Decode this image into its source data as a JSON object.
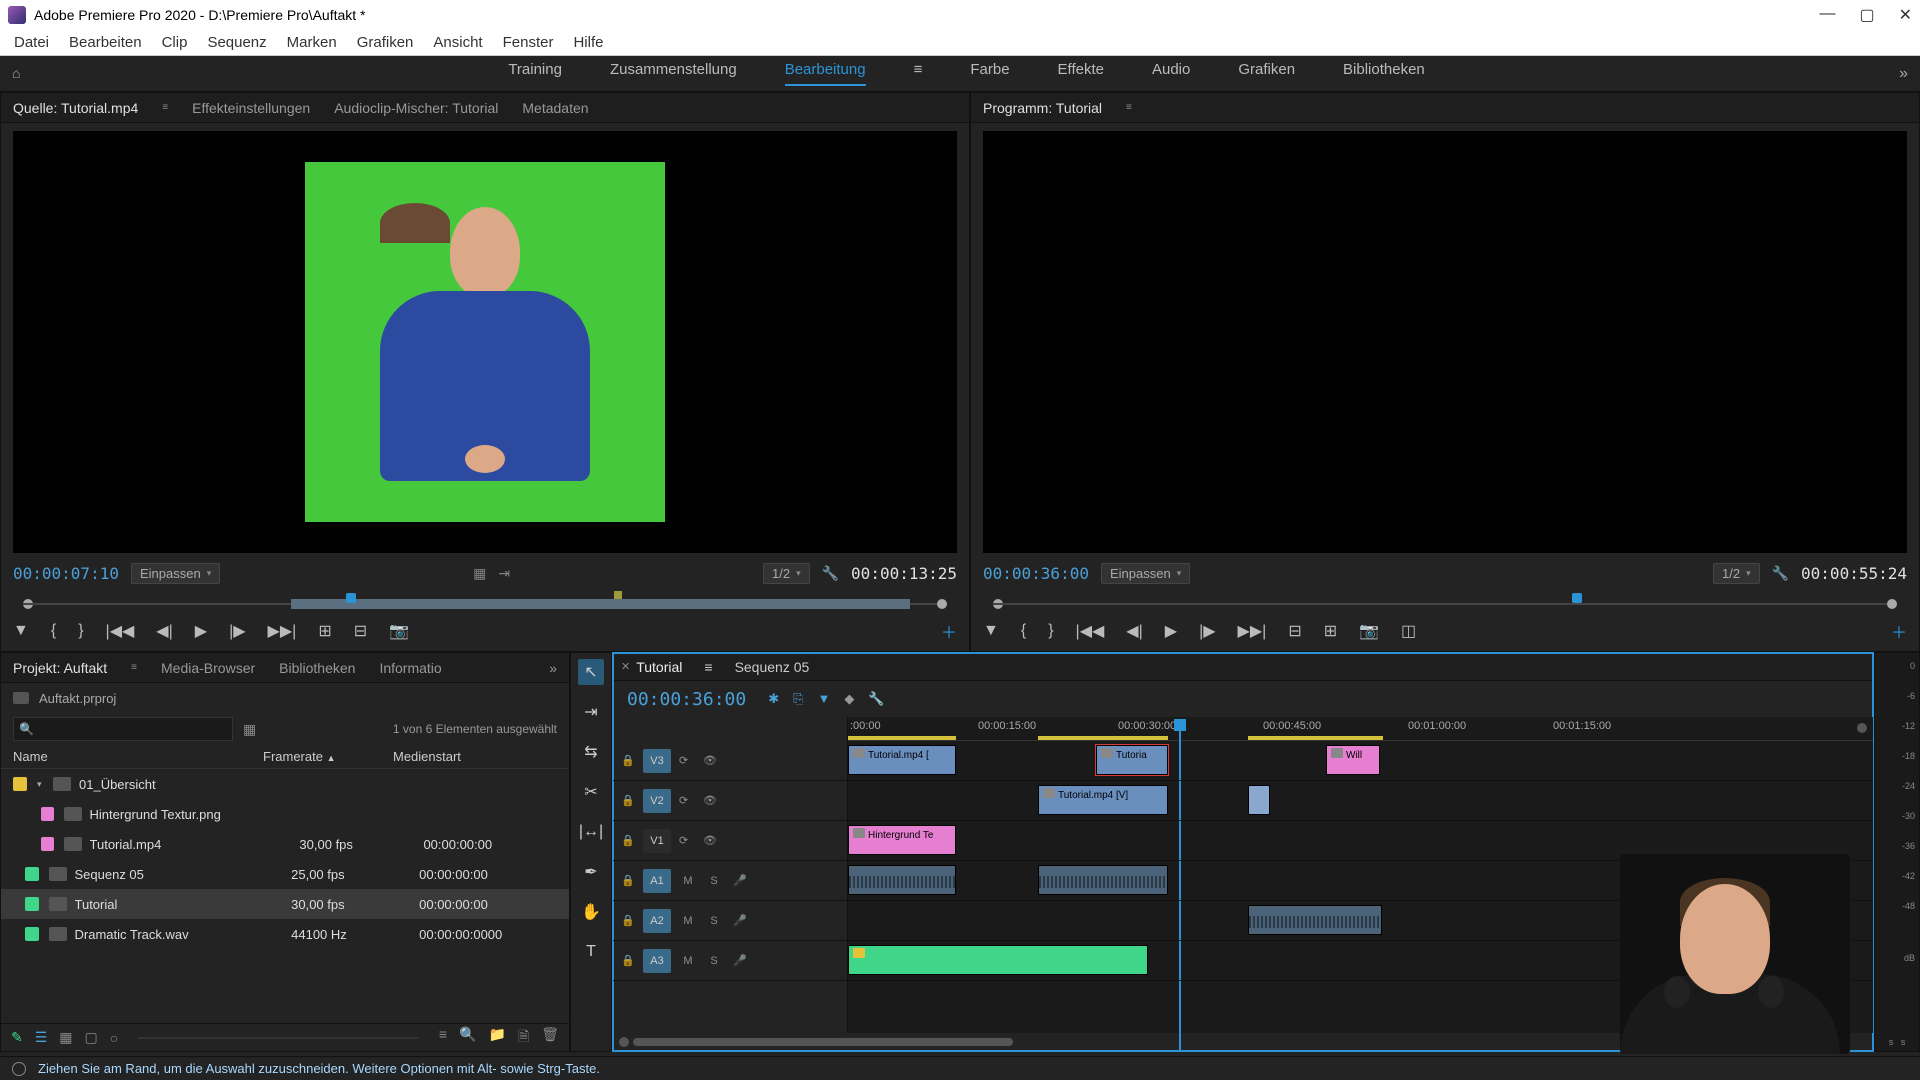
{
  "titlebar": {
    "text": "Adobe Premiere Pro 2020 - D:\\Premiere Pro\\Auftakt *"
  },
  "menu": [
    "Datei",
    "Bearbeiten",
    "Clip",
    "Sequenz",
    "Marken",
    "Grafiken",
    "Ansicht",
    "Fenster",
    "Hilfe"
  ],
  "workspace": {
    "tabs": [
      "Training",
      "Zusammenstellung",
      "Bearbeitung",
      "Farbe",
      "Effekte",
      "Audio",
      "Grafiken",
      "Bibliotheken"
    ],
    "active": "Bearbeitung"
  },
  "source": {
    "tabs": [
      "Quelle: Tutorial.mp4",
      "Effekteinstellungen",
      "Audioclip-Mischer: Tutorial",
      "Metadaten"
    ],
    "active_tab": 0,
    "tc_left": "00:00:07:10",
    "fit": "Einpassen",
    "zoom": "1/2",
    "tc_right": "00:00:13:25"
  },
  "program": {
    "tab": "Programm: Tutorial",
    "tc_left": "00:00:36:00",
    "fit": "Einpassen",
    "zoom": "1/2",
    "tc_right": "00:00:55:24"
  },
  "project": {
    "tabs": [
      "Projekt: Auftakt",
      "Media-Browser",
      "Bibliotheken",
      "Informatio"
    ],
    "filename": "Auftakt.prproj",
    "selection": "1 von 6 Elementen ausgewählt",
    "cols": [
      "Name",
      "Framerate",
      "Medienstart"
    ],
    "bin": "01_Übersicht",
    "items": [
      {
        "chip": "#e67ed1",
        "name": "Hintergrund Textur.png",
        "fr": "",
        "ms": ""
      },
      {
        "chip": "#e67ed1",
        "name": "Tutorial.mp4",
        "fr": "30,00 fps",
        "ms": "00:00:00:00"
      },
      {
        "chip": "#3fd68a",
        "name": "Sequenz 05",
        "fr": "25,00 fps",
        "ms": "00:00:00:00"
      },
      {
        "chip": "#3fd68a",
        "name": "Tutorial",
        "fr": "30,00 fps",
        "ms": "00:00:00:00",
        "sel": true
      },
      {
        "chip": "#3fd68a",
        "name": "Dramatic Track.wav",
        "fr": "44100  Hz",
        "ms": "00:00:00:0000"
      }
    ]
  },
  "timeline": {
    "tabs": [
      "Tutorial",
      "Sequenz 05"
    ],
    "tc": "00:00:36:00",
    "ruler": [
      ":00:00",
      "00:00:15:00",
      "00:00:30:00",
      "00:00:45:00",
      "00:01:00:00",
      "00:01:15:00"
    ],
    "tracks": {
      "V3": "V3",
      "V2": "V2",
      "V1": "V1",
      "A1": "A1",
      "A2": "A2",
      "A3": "A3"
    },
    "clips": {
      "v3_a": "Tutorial.mp4 [",
      "v3_b": "Tutoria",
      "v3_c": "Will",
      "v2_a": "Tutorial.mp4 [V]",
      "v1_a": "Hintergrund Te"
    }
  },
  "status": {
    "text": "Ziehen Sie am Rand, um die Auswahl zuzuschneiden. Weitere Optionen mit Alt- sowie Strg-Taste."
  },
  "meters": {
    "ticks": [
      "0",
      "-6",
      "-12",
      "-18",
      "-24",
      "-30",
      "-36",
      "-42",
      "-48",
      "-",
      "dB"
    ]
  }
}
